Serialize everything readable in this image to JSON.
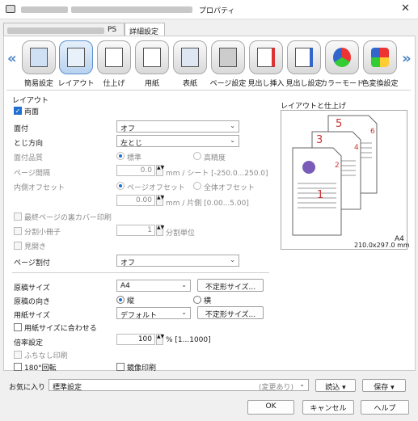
{
  "window": {
    "title_suffix": "プロパティ",
    "close_icon": "close-icon"
  },
  "tabs": [
    {
      "label": "PS"
    },
    {
      "label": "詳細設定"
    }
  ],
  "nav": {
    "prev": "«",
    "next": "»"
  },
  "categories": [
    {
      "label": "簡易設定",
      "icon": "quick-settings-icon"
    },
    {
      "label": "レイアウト",
      "icon": "layout-icon"
    },
    {
      "label": "仕上げ",
      "icon": "finishing-icon"
    },
    {
      "label": "用紙",
      "icon": "paper-icon"
    },
    {
      "label": "表紙",
      "icon": "cover-icon"
    },
    {
      "label": "ページ設定",
      "icon": "page-settings-icon"
    },
    {
      "label": "見出し挿入",
      "icon": "tab-insert-icon"
    },
    {
      "label": "見出し設定",
      "icon": "tab-settings-icon"
    },
    {
      "label": "カラーモード",
      "icon": "color-mode-icon"
    },
    {
      "label": "色変換設定",
      "icon": "color-conversion-icon"
    }
  ],
  "layout": {
    "section_title": "レイアウト",
    "duplex": "両面",
    "binding_label": "面付",
    "binding_value": "オフ",
    "direction_label": "とじ方向",
    "direction_value": "左とじ",
    "quality_label": "面付品質",
    "quality_std": "標準",
    "quality_high": "高精度",
    "gap_label": "ページ間隔",
    "gap_value": "0.0",
    "gap_unit": "mm / シート [-250.0...250.0]",
    "offset_label": "内側オフセット",
    "offset_page": "ページオフセット",
    "offset_all": "全体オフセット",
    "offset_value": "0.00",
    "offset_unit": "mm / 片側 [0.00...5.00]",
    "back_cover": "最終ページの裏カバー印刷",
    "split_label": "分割小冊子",
    "split_value": "1",
    "split_unit": "分割単位",
    "spread": "見開き",
    "page_split_label": "ページ割付",
    "page_split_value": "オフ"
  },
  "original": {
    "size_label": "原稿サイズ",
    "size_value": "A4",
    "custom_btn": "不定形サイズ...",
    "orient_label": "原稿の向き",
    "portrait": "縦",
    "landscape": "横",
    "paper_label": "用紙サイズ",
    "paper_value": "デフォルト",
    "paper_custom_btn": "不定形サイズ...",
    "fit": "用紙サイズに合わせる",
    "zoom_label": "倍率設定",
    "zoom_value": "100",
    "zoom_unit": "% [1...1000]",
    "borderless": "ふちなし印刷",
    "rotate": "180°回転",
    "mirror": "鏡像印刷"
  },
  "preview": {
    "title": "レイアウトと仕上げ",
    "size": "A4",
    "dims": "210.0x297.0 mm"
  },
  "footer": {
    "fav_label": "お気に入り",
    "fav_value": "標準設定",
    "fav_note": "(変更あり)",
    "load": "読込",
    "save": "保存",
    "ok": "OK",
    "cancel": "キャンセル",
    "help": "ヘルプ"
  }
}
